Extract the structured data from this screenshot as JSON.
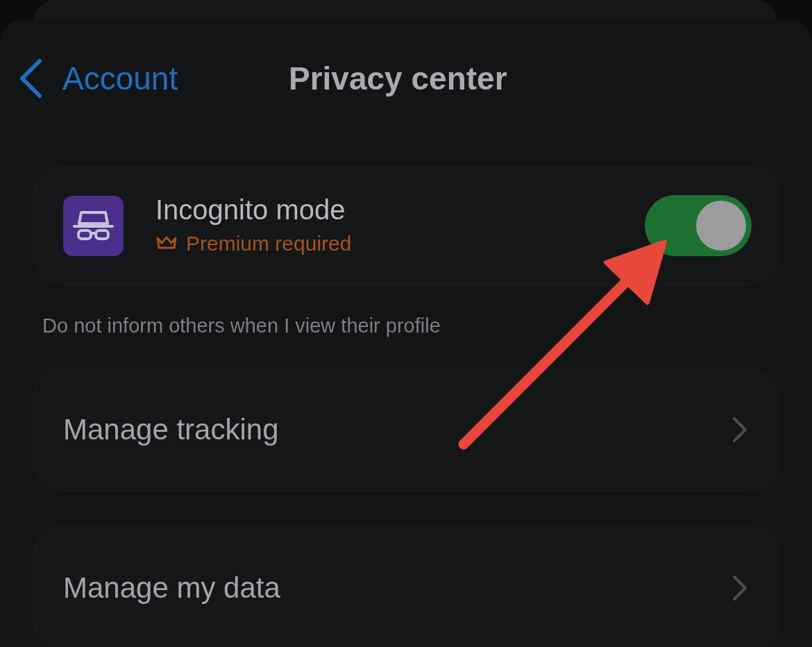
{
  "header": {
    "back_label": "Account",
    "title": "Privacy center"
  },
  "incognito": {
    "title": "Incognito mode",
    "badge": "Premium required",
    "on": true
  },
  "caption": "Do not inform others when I view their profile",
  "nav_rows": [
    {
      "label": "Manage tracking"
    },
    {
      "label": "Manage my data"
    }
  ]
}
